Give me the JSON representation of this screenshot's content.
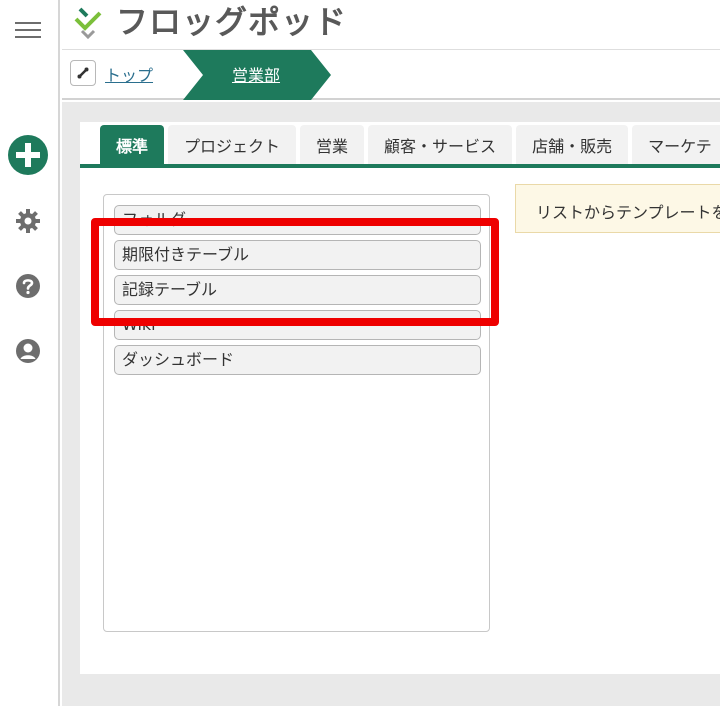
{
  "app": {
    "title": "フロッグポッド"
  },
  "breadcrumb": {
    "top_label": "トップ",
    "current_label": "営業部"
  },
  "tabs": [
    {
      "label": "標準",
      "active": true
    },
    {
      "label": "プロジェクト"
    },
    {
      "label": "営業"
    },
    {
      "label": "顧客・サービス"
    },
    {
      "label": "店舗・販売"
    },
    {
      "label": "マーケテ"
    }
  ],
  "templates": [
    {
      "label": "フォルダ"
    },
    {
      "label": "期限付きテーブル"
    },
    {
      "label": "記録テーブル"
    },
    {
      "label": "Wiki"
    },
    {
      "label": "ダッシュボード"
    }
  ],
  "info": {
    "text": "リストからテンプレートを"
  },
  "colors": {
    "accent": "#1e7a5c",
    "highlight": "#ee0000",
    "info_bg": "#fdf8e6",
    "link": "#2b6f8e"
  },
  "icons": [
    "menu-icon",
    "add-icon",
    "gear-icon",
    "help-icon",
    "user-icon",
    "link-icon",
    "logo-icon"
  ]
}
